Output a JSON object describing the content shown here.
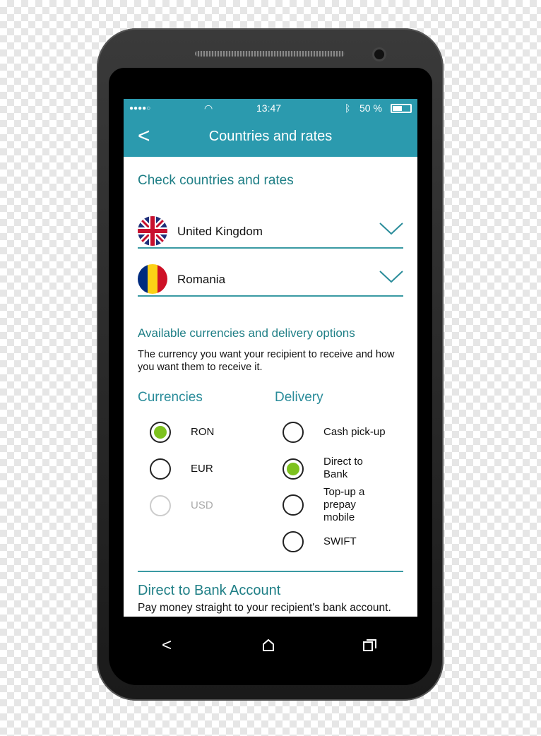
{
  "status_bar": {
    "signal": "●●●●○",
    "time": "13:47",
    "battery": "50 %"
  },
  "app_bar": {
    "title": "Countries and rates"
  },
  "main": {
    "heading": "Check countries and rates",
    "from_country": "United Kingdom",
    "to_country": "Romania",
    "options_heading": "Available currencies and delivery options",
    "options_description": "The currency you want your recipient to receive and how you want them to receive it.",
    "currencies_label": "Currencies",
    "delivery_label": "Delivery",
    "currencies": [
      {
        "label": "RON",
        "selected": true,
        "disabled": false
      },
      {
        "label": "EUR",
        "selected": false,
        "disabled": false
      },
      {
        "label": "USD",
        "selected": false,
        "disabled": true
      }
    ],
    "delivery": [
      {
        "label": "Cash pick-up",
        "selected": false
      },
      {
        "label": "Direct to Bank",
        "selected": true
      },
      {
        "label": "Top-up a prepay mobile",
        "selected": false
      },
      {
        "label": "SWIFT",
        "selected": false
      }
    ],
    "detail_heading": "Direct to Bank Account",
    "detail_text": "Pay money straight to your recipient's bank account."
  },
  "colors": {
    "accent": "#2b9aae",
    "heading": "#1f7f86",
    "selected": "#7dc21e"
  }
}
